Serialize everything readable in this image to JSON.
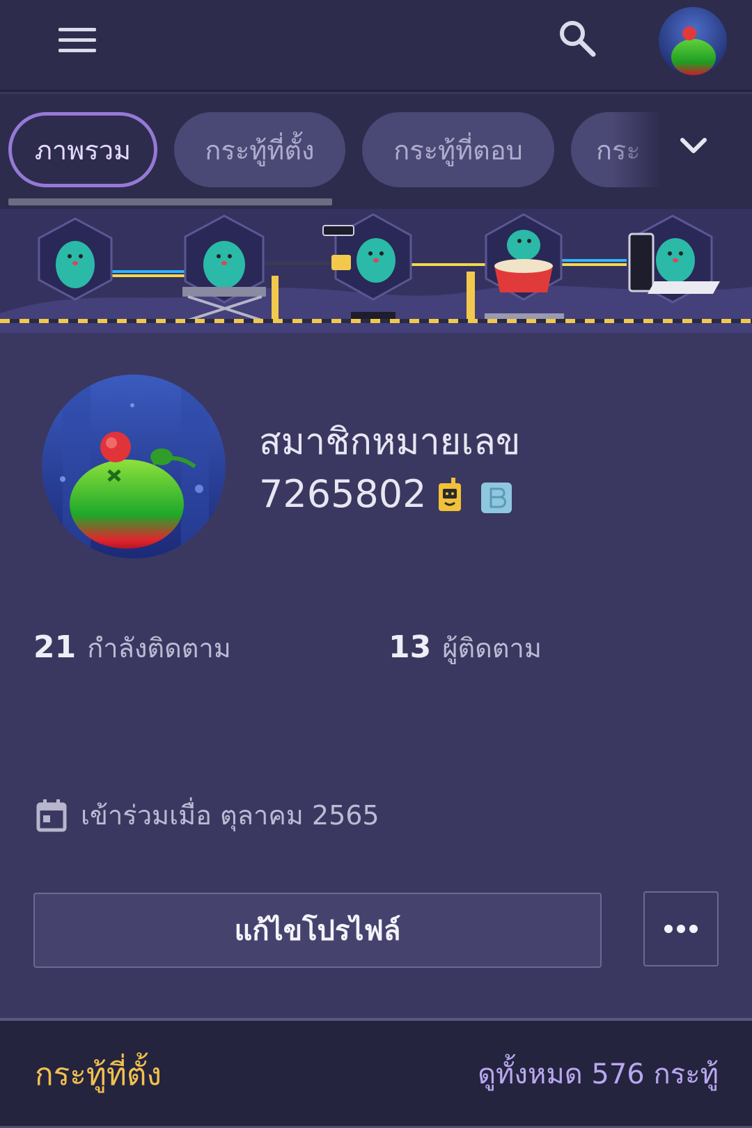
{
  "header": {
    "menu_icon": "hamburger-menu-icon",
    "search_icon": "search-icon",
    "avatar_icon": "user-avatar"
  },
  "tabs": [
    {
      "label": "ภาพรวม",
      "active": true
    },
    {
      "label": "กระทู้ที่ตั้ง",
      "active": false
    },
    {
      "label": "กระทู้ที่ตอบ",
      "active": false
    },
    {
      "label": "กระ",
      "active": false
    }
  ],
  "tabs_expand_icon": "chevron-down-icon",
  "profile": {
    "name": "สมาชิกหมายเลข",
    "member_id": "7265802",
    "badges": [
      "mascot-badge-icon",
      "b-badge-icon"
    ]
  },
  "stats": {
    "following_count": "21",
    "following_label": "กำลังติดตาม",
    "followers_count": "13",
    "followers_label": "ผู้ติดตาม"
  },
  "joined": {
    "icon": "calendar-icon",
    "text": "เข้าร่วมเมื่อ ตุลาคม 2565"
  },
  "actions": {
    "edit_label": "แก้ไขโปรไฟล์",
    "more_icon": "more-horizontal-icon"
  },
  "posts_section": {
    "title": "กระทู้ที่ตั้ง",
    "view_all": "ดูทั้งหมด 576 กระทู้"
  },
  "colors": {
    "background": "#3a3860",
    "topbar": "#2d2c4d",
    "tab_active_border": "#9679d6",
    "posts_title": "#f2c14e",
    "view_all": "#b9a8ef"
  }
}
